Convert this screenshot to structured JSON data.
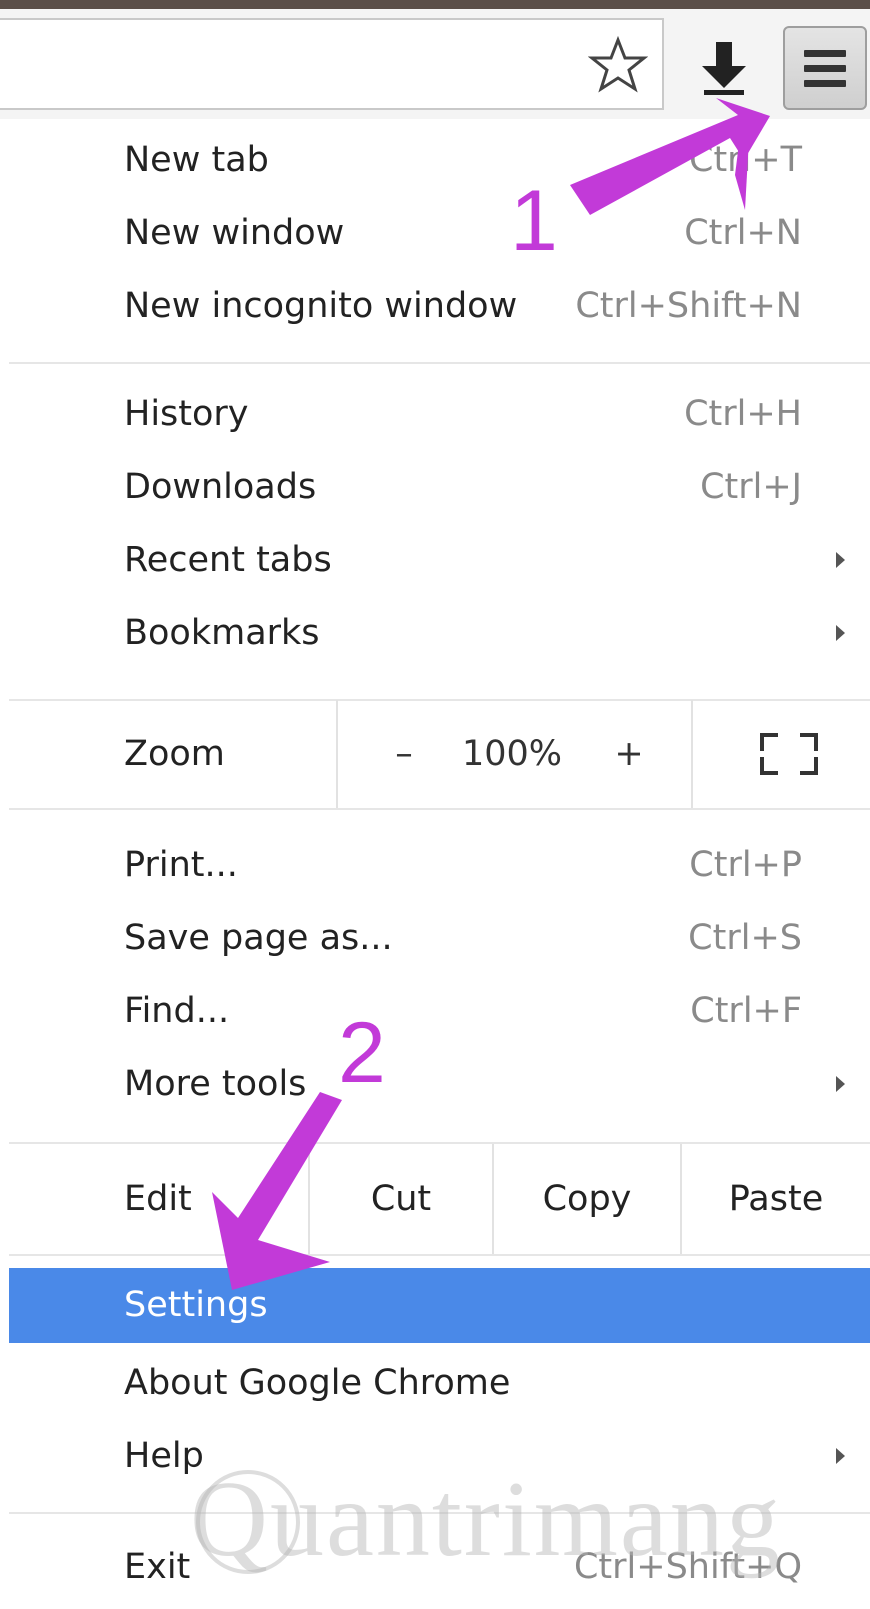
{
  "toolbar": {
    "star_icon": "star-outline-icon",
    "download_icon": "download-arrow-icon",
    "menu_icon": "hamburger-menu-icon"
  },
  "menu": {
    "group1": [
      {
        "label": "New tab",
        "shortcut": "Ctrl+T"
      },
      {
        "label": "New window",
        "shortcut": "Ctrl+N"
      },
      {
        "label": "New incognito window",
        "shortcut": "Ctrl+Shift+N"
      }
    ],
    "group2": [
      {
        "label": "History",
        "shortcut": "Ctrl+H"
      },
      {
        "label": "Downloads",
        "shortcut": "Ctrl+J"
      },
      {
        "label": "Recent tabs"
      },
      {
        "label": "Bookmarks"
      }
    ],
    "zoom": {
      "label": "Zoom",
      "minus": "–",
      "value": "100%",
      "plus": "+",
      "fullscreen_icon": "fullscreen-icon"
    },
    "group3": [
      {
        "label": "Print...",
        "shortcut": "Ctrl+P"
      },
      {
        "label": "Save page as...",
        "shortcut": "Ctrl+S"
      },
      {
        "label": "Find...",
        "shortcut": "Ctrl+F"
      },
      {
        "label": "More tools"
      }
    ],
    "edit": {
      "label": "Edit",
      "cut": "Cut",
      "copy": "Copy",
      "paste": "Paste"
    },
    "group4": [
      {
        "label": "Settings"
      },
      {
        "label": "About Google Chrome"
      },
      {
        "label": "Help"
      }
    ],
    "exit": {
      "label": "Exit",
      "shortcut": "Ctrl+Shift+Q"
    }
  },
  "annotations": {
    "step1": "1",
    "step2": "2",
    "color": "#c23ad8"
  },
  "watermark": "Quantrimang",
  "colors": {
    "highlight": "#4a89e8"
  }
}
